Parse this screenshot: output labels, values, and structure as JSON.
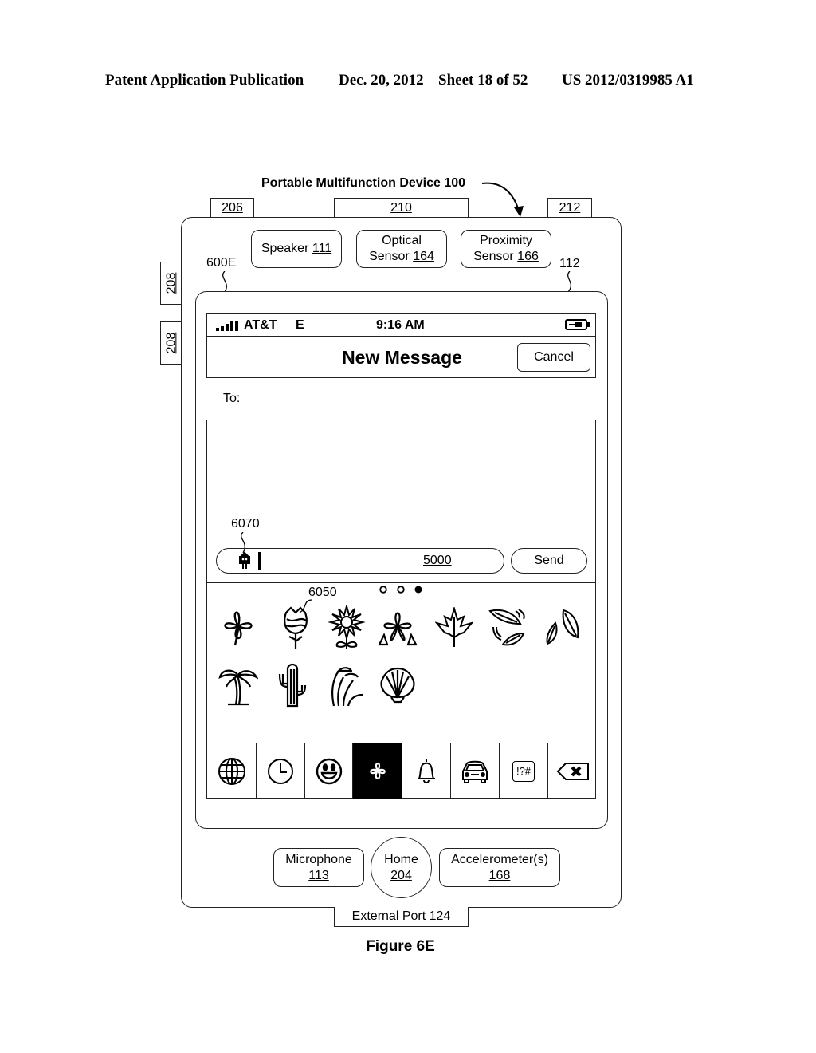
{
  "header": {
    "publication": "Patent Application Publication",
    "date": "Dec. 20, 2012",
    "sheet": "Sheet 18 of 52",
    "number": "US 2012/0319985 A1"
  },
  "device": {
    "title": "Portable Multifunction Device 100",
    "tabs": {
      "left": "206",
      "center": "210",
      "right": "212"
    },
    "side_buttons": [
      "208",
      "208"
    ],
    "speaker": {
      "label": "Speaker",
      "ref": "111"
    },
    "optical": {
      "line1": "Optical",
      "line2": "Sensor",
      "ref": "164"
    },
    "proximity": {
      "line1": "Proximity",
      "line2": "Sensor",
      "ref": "166"
    },
    "screen_ref": "600E",
    "touchscreen_ref": "112",
    "microphone": {
      "label": "Microphone",
      "ref": "113"
    },
    "home": {
      "label": "Home",
      "ref": "204"
    },
    "accelerometer": {
      "label": "Accelerometer(s)",
      "ref": "168"
    },
    "external_port": {
      "label": "External Port",
      "ref": "124"
    }
  },
  "phone": {
    "status": {
      "carrier": "AT&T",
      "network": "E",
      "time": "9:16 AM",
      "signal_icon": "signal-bars-icon",
      "battery_icon": "battery-charging-icon"
    },
    "nav": {
      "title": "New Message",
      "cancel": "Cancel"
    },
    "to_label": "To:",
    "input_ref": "6070",
    "input_underlined_value": "5000",
    "send": "Send",
    "page_dots": {
      "count": 3,
      "active": 3
    },
    "emoji_ref": "6050",
    "emoji_row1": [
      "four-leaf-clover",
      "rose",
      "sunflower",
      "hibiscus",
      "maple-leaf",
      "falling-leaves",
      "leaves"
    ],
    "emoji_row2": [
      "palm-tree",
      "cactus",
      "grass",
      "seashell"
    ],
    "keyboard_tabs": [
      {
        "icon": "globe-icon"
      },
      {
        "icon": "clock-icon"
      },
      {
        "icon": "smiley-icon"
      },
      {
        "icon": "flower-icon",
        "selected": true
      },
      {
        "icon": "bell-icon"
      },
      {
        "icon": "car-icon"
      },
      {
        "icon": "symbols-icon",
        "label": "!?#"
      },
      {
        "icon": "backspace-icon"
      }
    ]
  },
  "caption": "Figure 6E"
}
